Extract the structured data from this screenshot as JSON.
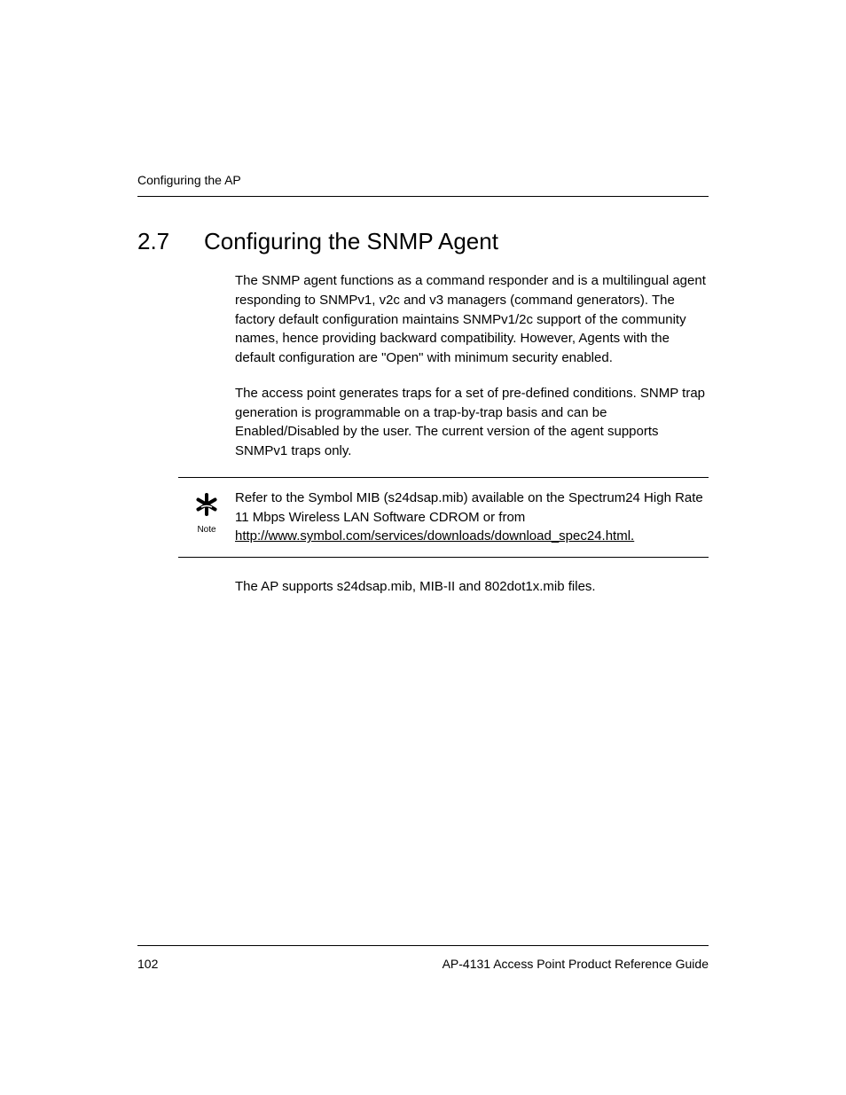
{
  "header": {
    "running_head": "Configuring the AP"
  },
  "section": {
    "number": "2.7",
    "title": "Configuring the SNMP Agent"
  },
  "paragraphs": {
    "p1": "The SNMP agent functions as a command responder and is a multilingual agent responding to SNMPv1, v2c and v3 managers (command generators). The factory default configuration maintains SNMPv1/2c support of the community names, hence providing backward compatibility. However, Agents with the default configuration are \"Open\" with minimum security enabled.",
    "p2": "The access point generates traps for a set of pre-defined conditions. SNMP trap generation is programmable on a trap-by-trap basis and can be Enabled/Disabled by the user. The current version of the agent supports SNMPv1 traps only.",
    "p3": "The AP supports s24dsap.mib, MIB-II and 802dot1x.mib files."
  },
  "note": {
    "label": "Note",
    "text_before_link": "Refer to the Symbol MIB (s24dsap.mib) available on the Spectrum24 High Rate 11 Mbps Wireless LAN Software CDROM or from ",
    "link": "http://www.symbol.com/services/downloads/download_spec24.html."
  },
  "footer": {
    "page_number": "102",
    "doc_title": "AP-4131 Access Point Product Reference Guide"
  }
}
